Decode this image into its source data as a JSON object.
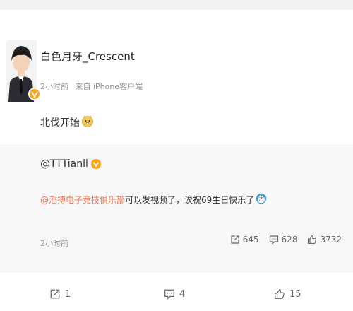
{
  "post": {
    "username": "白色月牙_Crescent",
    "time": "2小时前",
    "source": "来自 iPhone客户端",
    "text": "北伐开始"
  },
  "repost": {
    "author": "@TTTianll",
    "mention": "@滔搏电子竞技俱乐部",
    "text": " 可以发视频了，诶祝69生日快乐了",
    "time": "2小时前",
    "stats": {
      "repost_count": "645",
      "comment_count": "628",
      "like_count": "3732"
    }
  },
  "actions": {
    "repost": "1",
    "comment": "4",
    "like": "15"
  },
  "colors": {
    "accent": "#eb7350",
    "verified": "#f8a51c",
    "repost_bg": "#f7f7f7",
    "meta_gray": "#939393"
  },
  "icons": [
    "verified-badge-icon",
    "doge-emoji-icon",
    "doraemon-emoji-icon",
    "repost-icon",
    "comment-icon",
    "like-icon"
  ]
}
